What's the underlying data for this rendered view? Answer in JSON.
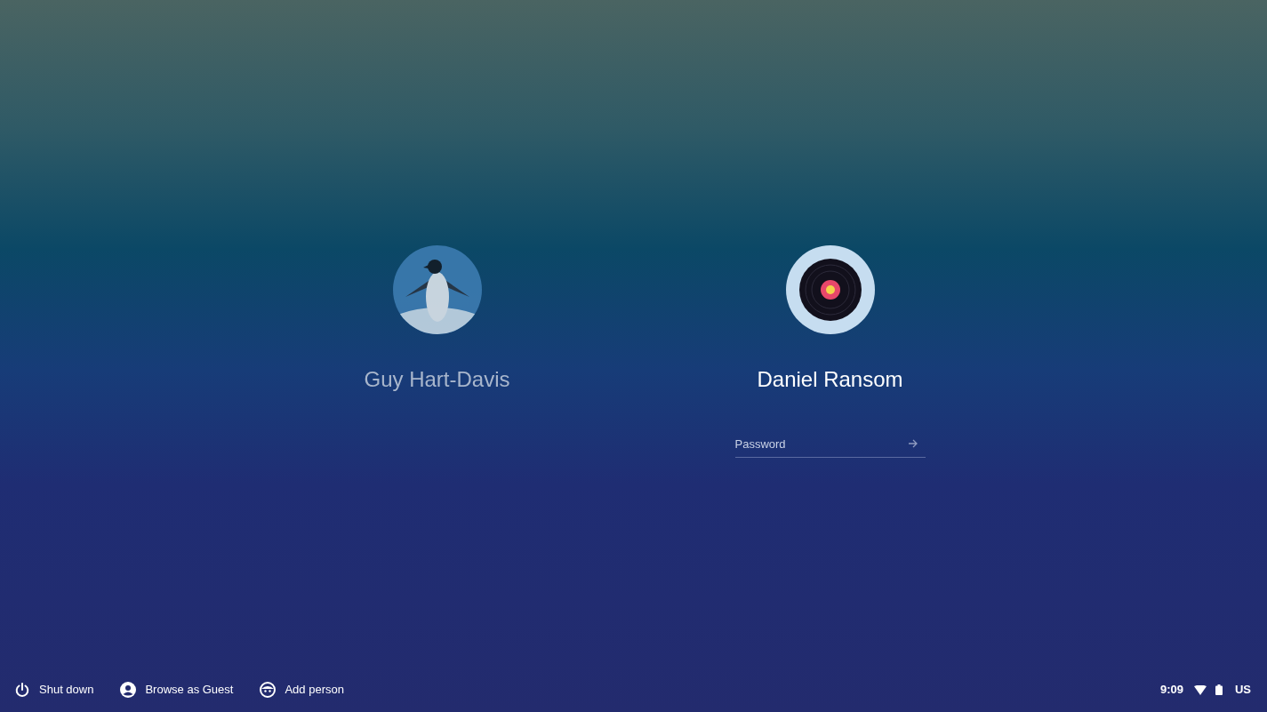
{
  "users": [
    {
      "name": "Guy Hart-Davis",
      "kind": "penguin",
      "selected": false
    },
    {
      "name": "Daniel Ransom",
      "kind": "record",
      "selected": true,
      "password_field": {
        "placeholder": "Password"
      }
    }
  ],
  "shelf_buttons": [
    {
      "label": "Shut down",
      "kind": "power"
    },
    {
      "label": "Browse as Guest",
      "kind": "guest"
    },
    {
      "label": "Add person",
      "kind": "add-person"
    }
  ],
  "status_tray": {
    "time": "9:09",
    "keyboard": "US"
  }
}
